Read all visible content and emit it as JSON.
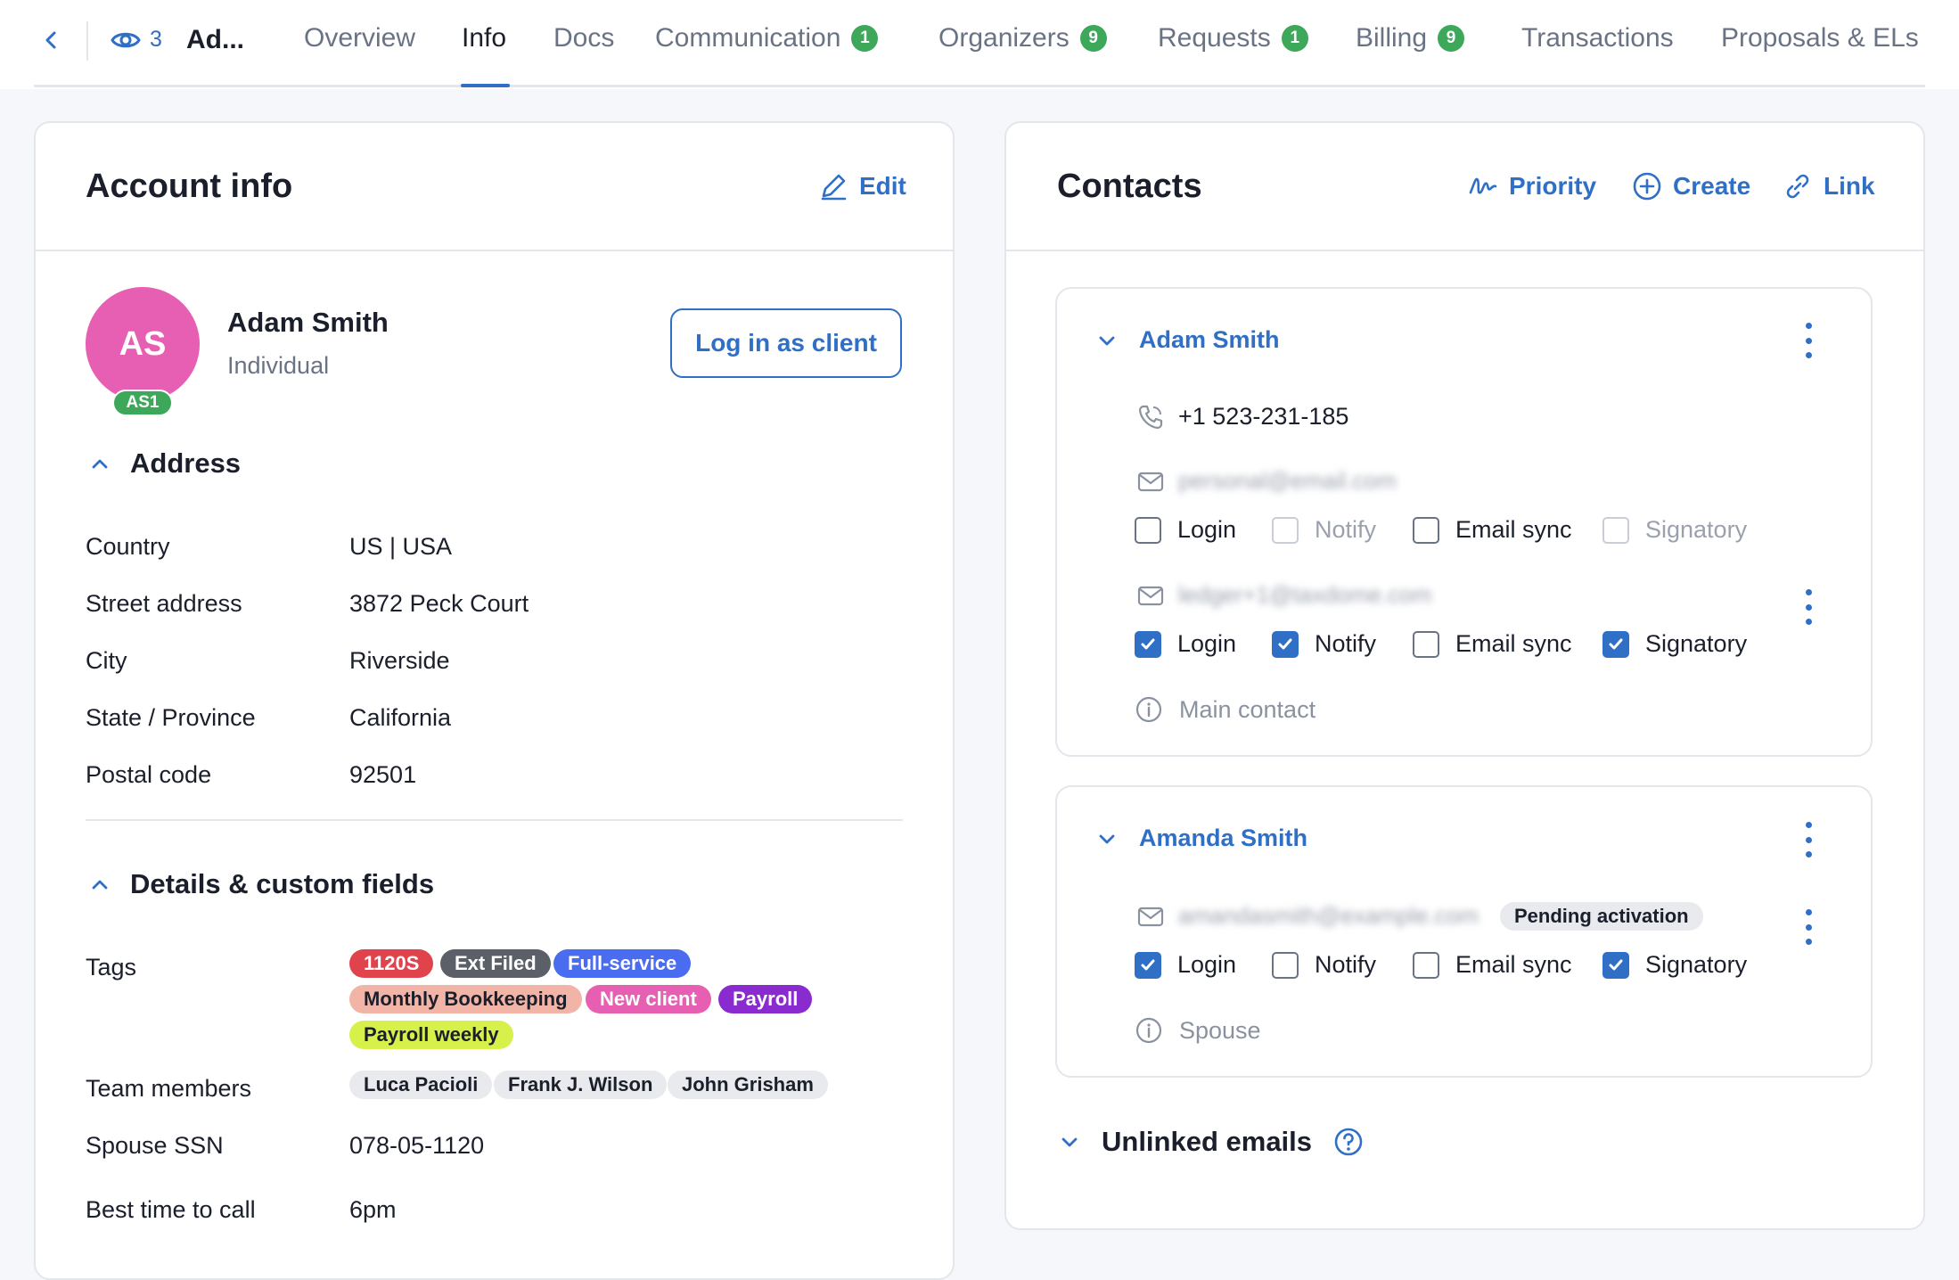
{
  "header": {
    "back_icon": "chevron-left-icon",
    "watch_icon": "eye-icon",
    "watch_count": "3",
    "account_short": "Ad...",
    "tabs": [
      {
        "label": "Overview",
        "badge": ""
      },
      {
        "label": "Info",
        "badge": "",
        "active": true
      },
      {
        "label": "Docs",
        "badge": ""
      },
      {
        "label": "Communication",
        "badge": "1"
      },
      {
        "label": "Organizers",
        "badge": "9"
      },
      {
        "label": "Requests",
        "badge": "1"
      },
      {
        "label": "Billing",
        "badge": "9"
      },
      {
        "label": "Transactions",
        "badge": ""
      },
      {
        "label": "Proposals & ELs",
        "badge": ""
      }
    ]
  },
  "account": {
    "title": "Account info",
    "edit_label": "Edit",
    "initials": "AS",
    "avatar_tag": "AS1",
    "avatar_color": "#e75fb2",
    "name": "Adam Smith",
    "type": "Individual",
    "login_as_client": "Log in as client",
    "address": {
      "heading": "Address",
      "rows": [
        {
          "label": "Country",
          "value": "US | USA"
        },
        {
          "label": "Street address",
          "value": "3872 Peck Court"
        },
        {
          "label": "City",
          "value": "Riverside"
        },
        {
          "label": "State / Province",
          "value": "California"
        },
        {
          "label": "Postal code",
          "value": "92501"
        }
      ]
    },
    "details": {
      "heading": "Details & custom fields",
      "tags_label": "Tags",
      "tags": [
        {
          "label": "1120S",
          "bg": "#e0434b",
          "fg": "#ffffff"
        },
        {
          "label": "Ext Filed",
          "bg": "#5b6068",
          "fg": "#ffffff"
        },
        {
          "label": "Full-service",
          "bg": "#4a6cf0",
          "fg": "#ffffff"
        },
        {
          "label": "Monthly Bookkeeping",
          "bg": "#f2b4a6",
          "fg": "#1a1f2b"
        },
        {
          "label": "New client",
          "bg": "#e75fb2",
          "fg": "#ffffff"
        },
        {
          "label": "Payroll",
          "bg": "#8a2bd0",
          "fg": "#ffffff"
        },
        {
          "label": "Payroll weekly",
          "bg": "#d8f04a",
          "fg": "#1a1f2b"
        }
      ],
      "team_label": "Team members",
      "team": [
        "Luca Pacioli",
        "Frank J. Wilson",
        "John Grisham"
      ],
      "rows": [
        {
          "label": "Spouse SSN",
          "value": "078-05-1120"
        },
        {
          "label": "Best time to call",
          "value": "6pm"
        }
      ]
    }
  },
  "contacts": {
    "title": "Contacts",
    "priority_label": "Priority",
    "create_label": "Create",
    "link_label": "Link",
    "people": [
      {
        "name": "Adam Smith",
        "phone": "+1 523-231-185",
        "emails": [
          {
            "address": "personal@email.com",
            "checks": {
              "login": "Login",
              "notify": "Notify",
              "sync": "Email sync",
              "signatory": "Signatory"
            }
          },
          {
            "address": "ledger+1@taxdome.com",
            "checks": {
              "login": "Login",
              "notify": "Notify",
              "sync": "Email sync",
              "signatory": "Signatory"
            }
          }
        ],
        "note": "Main contact"
      },
      {
        "name": "Amanda Smith",
        "emails": [
          {
            "address": "amandasmith@example.com",
            "status": "Pending activation",
            "checks": {
              "login": "Login",
              "notify": "Notify",
              "sync": "Email sync",
              "signatory": "Signatory"
            }
          }
        ],
        "note": "Spouse"
      }
    ],
    "unlinked_label": "Unlinked emails"
  },
  "colors": {
    "accent": "#2f6fc6",
    "badge_green": "#3ea85a"
  }
}
